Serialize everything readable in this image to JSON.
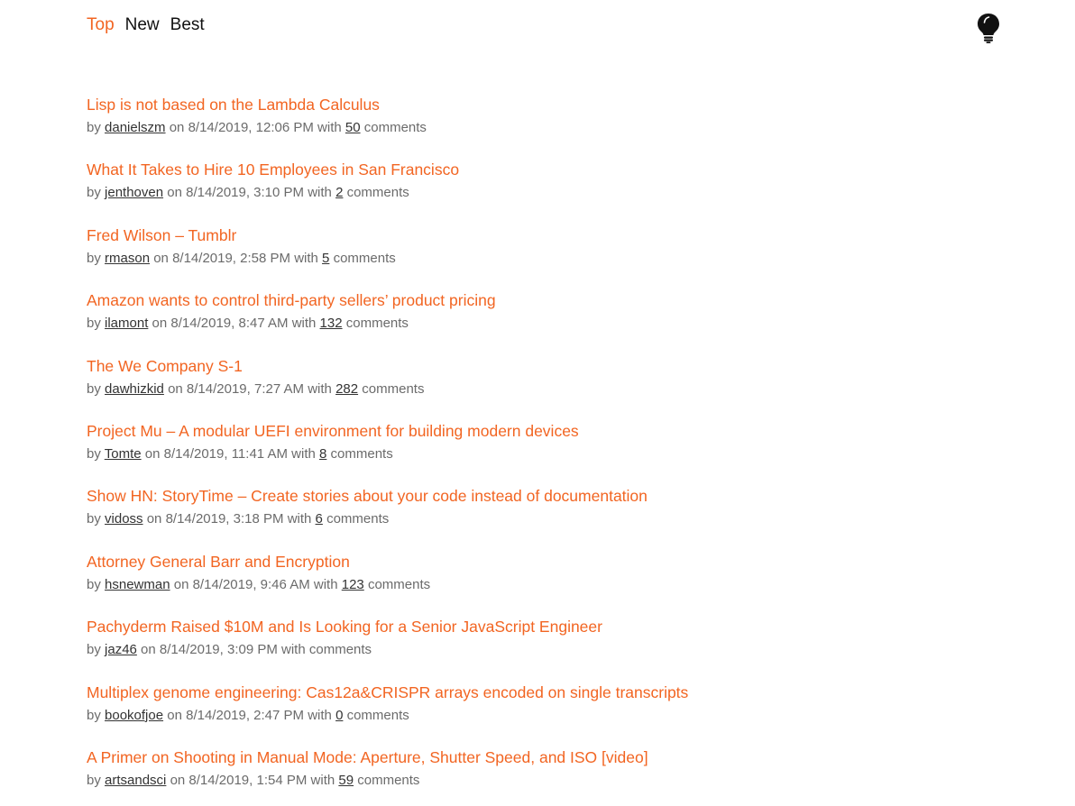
{
  "nav": {
    "tabs": [
      {
        "label": "Top",
        "active": true
      },
      {
        "label": "New",
        "active": false
      },
      {
        "label": "Best",
        "active": false
      }
    ],
    "theme_icon": "lightbulb-icon"
  },
  "colors": {
    "accent": "#f26522",
    "text": "#111111",
    "meta": "#6b6b6b"
  },
  "stories": [
    {
      "title": "Lisp is not based on the Lambda Calculus",
      "by": "by",
      "author": "danielszm",
      "on": "on",
      "date": "8/14/2019, 12:06 PM",
      "with": "with",
      "comments": "50",
      "comments_label": "comments"
    },
    {
      "title": "What It Takes to Hire 10 Employees in San Francisco",
      "by": "by",
      "author": "jenthoven",
      "on": "on",
      "date": "8/14/2019, 3:10 PM",
      "with": "with",
      "comments": "2",
      "comments_label": "comments"
    },
    {
      "title": "Fred Wilson – Tumblr",
      "by": "by",
      "author": "rmason",
      "on": "on",
      "date": "8/14/2019, 2:58 PM",
      "with": "with",
      "comments": "5",
      "comments_label": "comments"
    },
    {
      "title": "Amazon wants to control third-party sellers’ product pricing",
      "by": "by",
      "author": "ilamont",
      "on": "on",
      "date": "8/14/2019, 8:47 AM",
      "with": "with",
      "comments": "132",
      "comments_label": "comments"
    },
    {
      "title": "The We Company S-1",
      "by": "by",
      "author": "dawhizkid",
      "on": "on",
      "date": "8/14/2019, 7:27 AM",
      "with": "with",
      "comments": "282",
      "comments_label": "comments"
    },
    {
      "title": "Project Mu – A modular UEFI environment for building modern devices",
      "by": "by",
      "author": "Tomte",
      "on": "on",
      "date": "8/14/2019, 11:41 AM",
      "with": "with",
      "comments": "8",
      "comments_label": "comments"
    },
    {
      "title": "Show HN: StoryTime – Create stories about your code instead of documentation",
      "by": "by",
      "author": "vidoss",
      "on": "on",
      "date": "8/14/2019, 3:18 PM",
      "with": "with",
      "comments": "6",
      "comments_label": "comments"
    },
    {
      "title": "Attorney General Barr and Encryption",
      "by": "by",
      "author": "hsnewman",
      "on": "on",
      "date": "8/14/2019, 9:46 AM",
      "with": "with",
      "comments": "123",
      "comments_label": "comments"
    },
    {
      "title": "Pachyderm Raised $10M and Is Looking for a Senior JavaScript Engineer",
      "by": "by",
      "author": "jaz46",
      "on": "on",
      "date": "8/14/2019, 3:09 PM",
      "with": "with",
      "comments": "",
      "comments_label": "comments"
    },
    {
      "title": "Multiplex genome engineering: Cas12a&CRISPR arrays encoded on single transcripts",
      "by": "by",
      "author": "bookofjoe",
      "on": "on",
      "date": "8/14/2019, 2:47 PM",
      "with": "with",
      "comments": "0",
      "comments_label": "comments"
    },
    {
      "title": "A Primer on Shooting in Manual Mode: Aperture, Shutter Speed, and ISO [video]",
      "by": "by",
      "author": "artsandsci",
      "on": "on",
      "date": "8/14/2019, 1:54 PM",
      "with": "with",
      "comments": "59",
      "comments_label": "comments"
    }
  ]
}
